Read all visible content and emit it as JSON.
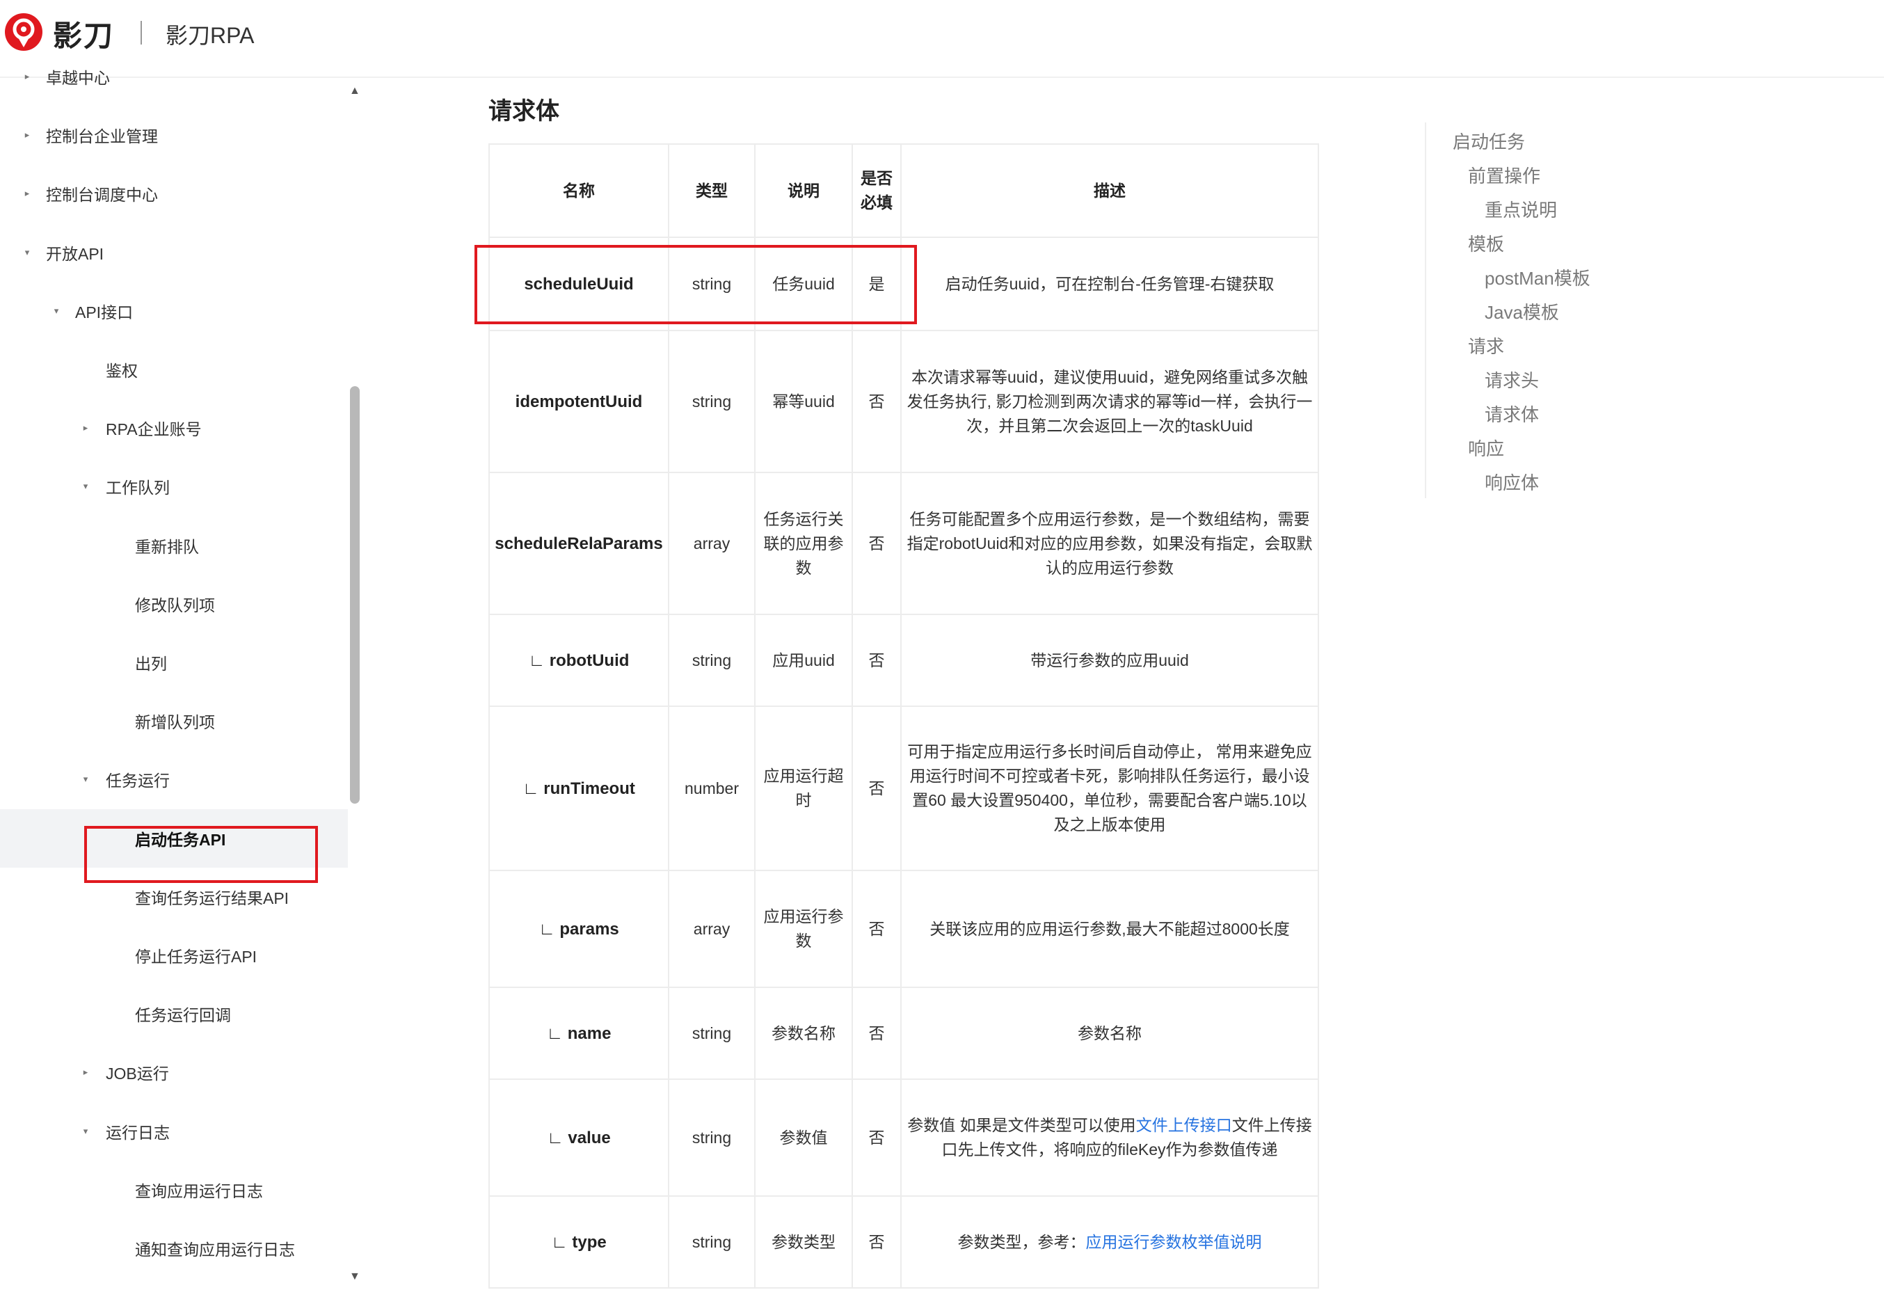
{
  "header": {
    "brand_name": "影刀",
    "product_name": "影刀RPA"
  },
  "sidebar": {
    "items": [
      {
        "label": "卓越中心",
        "caret": "▸",
        "active": false
      },
      {
        "label": "控制台企业管理",
        "caret": "▸",
        "active": false
      },
      {
        "label": "控制台调度中心",
        "caret": "▸",
        "active": false
      },
      {
        "label": "开放API",
        "caret": "▾",
        "active": false
      },
      {
        "label": "API接口",
        "caret": "▾",
        "active": false
      },
      {
        "label": "鉴权",
        "caret": "",
        "active": false
      },
      {
        "label": "RPA企业账号",
        "caret": "▸",
        "active": false
      },
      {
        "label": "工作队列",
        "caret": "▾",
        "active": false
      },
      {
        "label": "重新排队",
        "caret": "",
        "active": false
      },
      {
        "label": "修改队列项",
        "caret": "",
        "active": false
      },
      {
        "label": "出列",
        "caret": "",
        "active": false
      },
      {
        "label": "新增队列项",
        "caret": "",
        "active": false
      },
      {
        "label": "任务运行",
        "caret": "▾",
        "active": false
      },
      {
        "label": "启动任务API",
        "caret": "",
        "active": true
      },
      {
        "label": "查询任务运行结果API",
        "caret": "",
        "active": false
      },
      {
        "label": "停止任务运行API",
        "caret": "",
        "active": false
      },
      {
        "label": "任务运行回调",
        "caret": "",
        "active": false
      },
      {
        "label": "JOB运行",
        "caret": "▸",
        "active": false
      },
      {
        "label": "运行日志",
        "caret": "▾",
        "active": false
      },
      {
        "label": "查询应用运行日志",
        "caret": "",
        "active": false
      },
      {
        "label": "通知查询应用运行日志",
        "caret": "",
        "active": false
      }
    ]
  },
  "main": {
    "section_title": "请求体",
    "table": {
      "headers": {
        "name": "名称",
        "type": "类型",
        "note": "说明",
        "required_1": "是否",
        "required_2": "必填",
        "desc": "描述"
      },
      "rows": [
        {
          "name": "scheduleUuid",
          "type": "string",
          "note": "任务uuid",
          "required": "是",
          "desc": "启动任务uuid，可在控制台-任务管理-右键获取"
        },
        {
          "name": "idempotentUuid",
          "type": "string",
          "note": "幂等uuid",
          "required": "否",
          "desc": "本次请求幂等uuid，建议使用uuid，避免网络重试多次触发任务执行, 影刀检测到两次请求的幂等id一样，会执行一次，并且第二次会返回上一次的taskUuid"
        },
        {
          "name": "scheduleRelaParams",
          "type": "array",
          "note": "任务运行关联的应用参数",
          "required": "否",
          "desc": "任务可能配置多个应用运行参数，是一个数组结构，需要指定robotUuid和对应的应用参数，如果没有指定，会取默认的应用运行参数"
        },
        {
          "name": "∟ robotUuid",
          "type": "string",
          "note": "应用uuid",
          "required": "否",
          "desc": "带运行参数的应用uuid"
        },
        {
          "name": "∟ runTimeout",
          "type": "number",
          "note": "应用运行超时",
          "required": "否",
          "desc": "可用于指定应用运行多长时间后自动停止， 常用来避免应用运行时间不可控或者卡死，影响排队任务运行，最小设置60 最大设置950400，单位秒，需要配合客户端5.10以及之上版本使用"
        },
        {
          "name": "∟ params",
          "type": "array",
          "note": "应用运行参数",
          "required": "否",
          "desc": "关联该应用的应用运行参数,最大不能超过8000长度"
        },
        {
          "name": "∟ name",
          "type": "string",
          "note": "参数名称",
          "required": "否",
          "desc": "参数名称"
        },
        {
          "name": "∟ value",
          "type": "string",
          "note": "参数值",
          "required": "否",
          "desc_pre": "参数值 如果是文件类型可以使用",
          "desc_link": "文件上传接口",
          "desc_post": "文件上传接口先上传文件，将响应的fileKey作为参数值传递"
        },
        {
          "name": "∟ type",
          "type": "string",
          "note": "参数类型",
          "required": "否",
          "desc_pre": "参数类型，参考：",
          "desc_link": "应用运行参数枚举值说明",
          "desc_post": ""
        }
      ]
    }
  },
  "toc": {
    "items": [
      {
        "label": "启动任务",
        "level": 0
      },
      {
        "label": "前置操作",
        "level": 1
      },
      {
        "label": "重点说明",
        "level": 2
      },
      {
        "label": "模板",
        "level": 1
      },
      {
        "label": "postMan模板",
        "level": 2
      },
      {
        "label": "Java模板",
        "level": 2
      },
      {
        "label": "请求",
        "level": 1
      },
      {
        "label": "请求头",
        "level": 2
      },
      {
        "label": "请求体",
        "level": 2
      },
      {
        "label": "响应",
        "level": 1
      },
      {
        "label": "响应体",
        "level": 2
      }
    ]
  },
  "colors": {
    "accent_link": "#2673e0",
    "highlight_red": "#e0191f",
    "brand_red": "#e0191f"
  },
  "icons": {
    "logo": "yingdao-logo-icon",
    "expand": "caret-down-icon",
    "collapse": "caret-right-icon"
  }
}
